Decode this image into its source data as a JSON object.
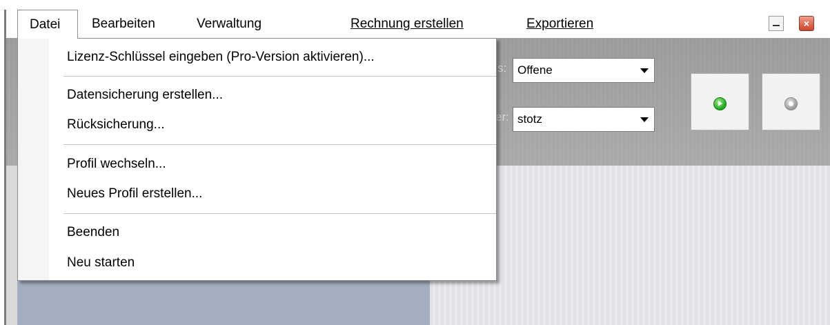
{
  "menubar": {
    "items": [
      {
        "label": "Datei"
      },
      {
        "label": "Bearbeiten"
      },
      {
        "label": "Verwaltung"
      },
      {
        "label": "Rechnung erstellen"
      },
      {
        "label": "Exportieren"
      }
    ]
  },
  "window_controls": {
    "minimize": "minimize-icon",
    "close": "close-icon",
    "close_color": "#d0482c"
  },
  "filters": {
    "status": {
      "label_fragment": "s:",
      "value": "Offene"
    },
    "user": {
      "label_fragment": "er:",
      "value": "stotz"
    }
  },
  "buttons": {
    "start": "play-icon",
    "stop": "stop-icon"
  },
  "datei_menu": {
    "items": [
      {
        "label": "Lizenz-Schlüssel eingeben (Pro-Version aktivieren)..."
      },
      {
        "label": "Datensicherung erstellen..."
      },
      {
        "label": "Rücksicherung..."
      },
      {
        "label": "Profil wechseln..."
      },
      {
        "label": "Neues Profil erstellen..."
      },
      {
        "label": "Beenden"
      },
      {
        "label": "Neu starten"
      }
    ]
  }
}
